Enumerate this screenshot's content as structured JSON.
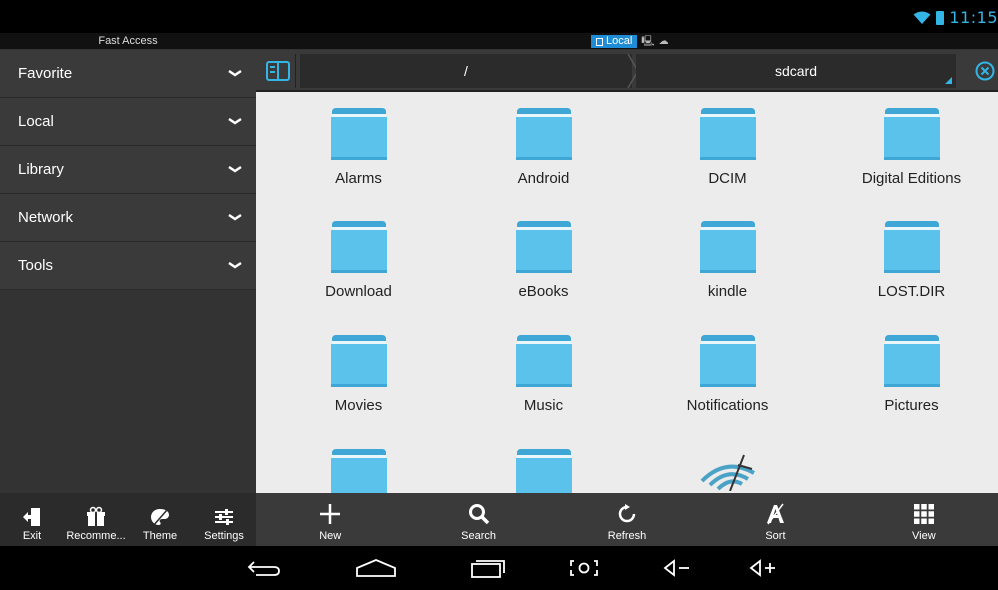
{
  "status": {
    "time": "11:15"
  },
  "subheader": {
    "fast_access": "Fast Access",
    "local_tab": "Local"
  },
  "sidebar": {
    "items": [
      {
        "label": "Favorite"
      },
      {
        "label": "Local"
      },
      {
        "label": "Library"
      },
      {
        "label": "Network"
      },
      {
        "label": "Tools"
      }
    ]
  },
  "path": {
    "root": "/",
    "current": "sdcard"
  },
  "folders": [
    "Alarms",
    "Android",
    "DCIM",
    "Digital Editions",
    "Download",
    "eBooks",
    "kindle",
    "LOST.DIR",
    "Movies",
    "Music",
    "Notifications",
    "Pictures"
  ],
  "bottom_left": {
    "exit": "Exit",
    "recommend": "Recomme...",
    "theme": "Theme",
    "settings": "Settings"
  },
  "bottom_right": {
    "new": "New",
    "search": "Search",
    "refresh": "Refresh",
    "sort": "Sort",
    "view": "View"
  },
  "colors": {
    "accent": "#33b5e5",
    "folder": "#5bc2ec",
    "folder_dark": "#3fa7d6",
    "content_bg": "#ececec"
  },
  "icons": {
    "wifi": "wifi-icon",
    "battery": "battery-icon",
    "path_toggle": "storage-toggle-icon",
    "close": "close-circle-icon",
    "chevron": "chevron-down-icon"
  }
}
